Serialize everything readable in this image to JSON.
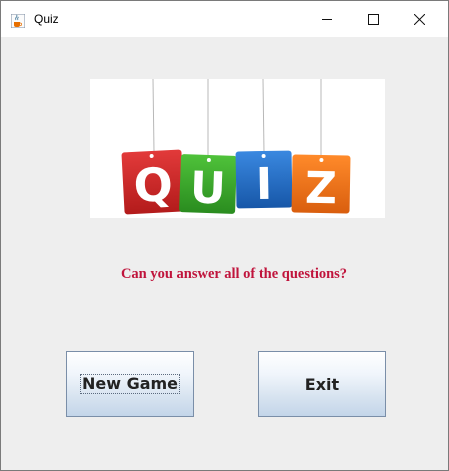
{
  "window": {
    "title": "Quiz"
  },
  "logo": {
    "letters": [
      "Q",
      "U",
      "I",
      "Z"
    ]
  },
  "content": {
    "question": "Can you answer all of the questions?"
  },
  "buttons": {
    "new_game": "New Game",
    "exit": "Exit"
  },
  "colors": {
    "letter_q": "#d42a2a",
    "letter_u": "#3eaa2a",
    "letter_i": "#1f70c8",
    "letter_z": "#f07418",
    "question_text": "#c0143c"
  },
  "icons": {
    "app": "java-cup-icon",
    "minimize": "minimize-icon",
    "maximize": "maximize-icon",
    "close": "close-icon"
  }
}
